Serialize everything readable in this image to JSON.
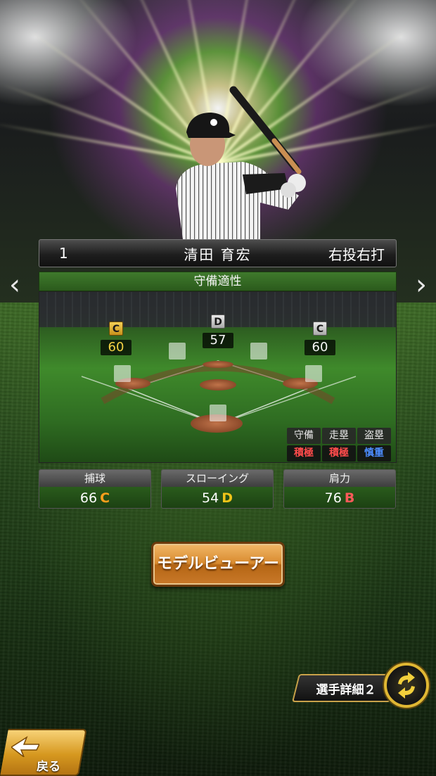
{
  "player": {
    "number": "1",
    "name": "清田 育宏",
    "handedness": "右投右打"
  },
  "defense": {
    "header": "守備適性",
    "positions": [
      {
        "id": "left-field",
        "grade": "C",
        "value": "60",
        "highlight": true
      },
      {
        "id": "center-field",
        "grade": "D",
        "value": "57",
        "highlight": false
      },
      {
        "id": "right-field",
        "grade": "C",
        "value": "60",
        "highlight": false
      }
    ]
  },
  "tendencies": {
    "headers": [
      "守備",
      "走塁",
      "盗塁"
    ],
    "values": [
      "積極",
      "積極",
      "慎重"
    ],
    "colors": [
      "#ff4b4b",
      "#ff4b4b",
      "#4d8dff"
    ]
  },
  "stats": [
    {
      "label": "捕球",
      "value": "66",
      "grade": "C",
      "grade_color": "#ff9f1c"
    },
    {
      "label": "スローイング",
      "value": "54",
      "grade": "D",
      "grade_color": "#f0c419"
    },
    {
      "label": "肩力",
      "value": "76",
      "grade": "B",
      "grade_color": "#ff5a5a"
    }
  ],
  "buttons": {
    "model_viewer": "モデルビューアー",
    "player_detail": "選手詳細２",
    "back": "戻る",
    "prev": "‹",
    "next": "›"
  }
}
